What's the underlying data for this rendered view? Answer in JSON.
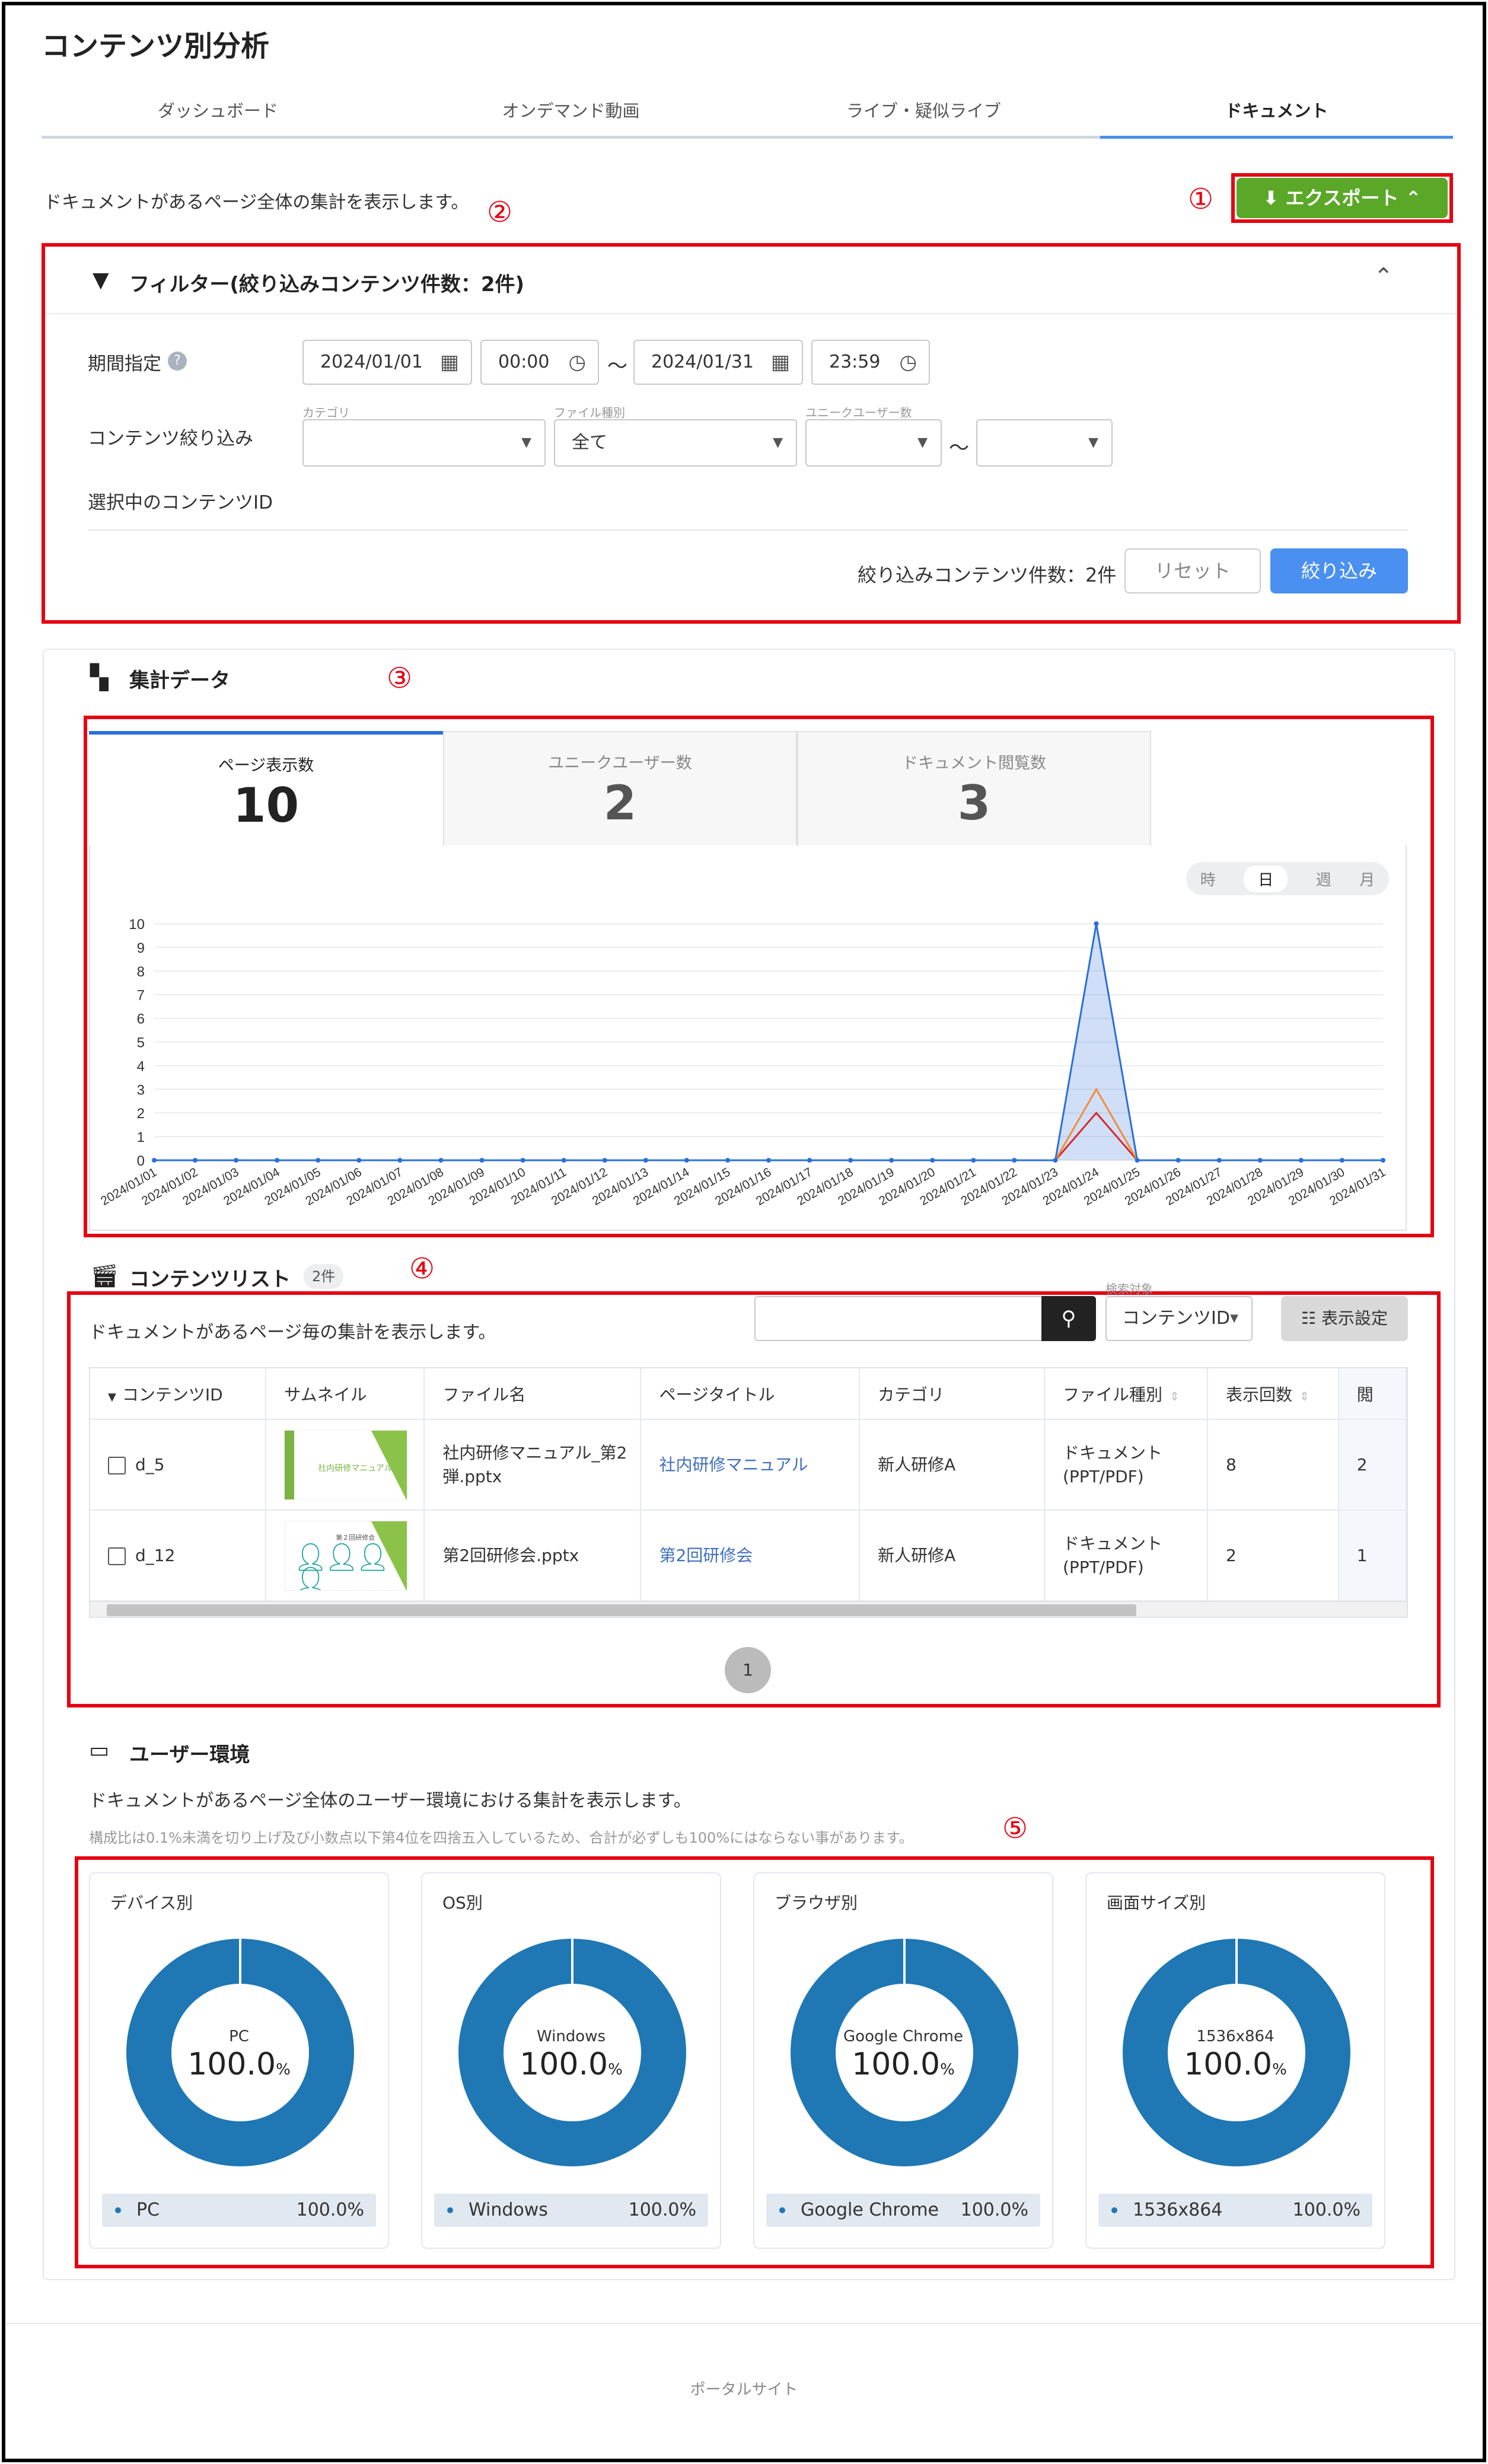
{
  "page": {
    "title": "コンテンツ別分析",
    "tabs": [
      "ダッシュボード",
      "オンデマンド動画",
      "ライブ・疑似ライブ",
      "ドキュメント"
    ],
    "description": "ドキュメントがあるページ全体の集計を表示します。",
    "export_label": "エクスポート",
    "markers": [
      "①",
      "②",
      "③",
      "④",
      "⑤"
    ],
    "footer": "ポータルサイト"
  },
  "filter": {
    "title": "フィルター(絞り込みコンテンツ件数：2件)",
    "period_label": "期間指定",
    "start_date": "2024/01/01",
    "start_time": "00:00",
    "range_sep": "～",
    "end_date": "2024/01/31",
    "end_time": "23:59",
    "content_filter_label": "コンテンツ絞り込み",
    "category_label": "カテゴリ",
    "category_value": "",
    "filetype_label": "ファイル種別",
    "filetype_value": "全て",
    "unique_users_label": "ユニークユーザー数",
    "selected_ids_label": "選択中のコンテンツID",
    "count_text": "絞り込みコンテンツ件数：2件",
    "reset_label": "リセット",
    "apply_label": "絞り込み"
  },
  "summary": {
    "title": "集計データ",
    "metrics": [
      {
        "label": "ページ表示数",
        "value": "10"
      },
      {
        "label": "ユニークユーザー数",
        "value": "2"
      },
      {
        "label": "ドキュメント閲覧数",
        "value": "3"
      }
    ],
    "granularity": [
      "時",
      "日",
      "週",
      "月"
    ],
    "granularity_selected": "日"
  },
  "chart_data": {
    "type": "area",
    "x": [
      "2024/01/01",
      "2024/01/02",
      "2024/01/03",
      "2024/01/04",
      "2024/01/05",
      "2024/01/06",
      "2024/01/07",
      "2024/01/08",
      "2024/01/09",
      "2024/01/10",
      "2024/01/11",
      "2024/01/12",
      "2024/01/13",
      "2024/01/14",
      "2024/01/15",
      "2024/01/16",
      "2024/01/17",
      "2024/01/18",
      "2024/01/19",
      "2024/01/20",
      "2024/01/21",
      "2024/01/22",
      "2024/01/23",
      "2024/01/24",
      "2024/01/25",
      "2024/01/26",
      "2024/01/27",
      "2024/01/28",
      "2024/01/29",
      "2024/01/30",
      "2024/01/31"
    ],
    "ylim": [
      0,
      10
    ],
    "yticks": [
      0,
      1,
      2,
      3,
      4,
      5,
      6,
      7,
      8,
      9,
      10
    ],
    "series": [
      {
        "color": "#2a6fdb",
        "values": [
          0,
          0,
          0,
          0,
          0,
          0,
          0,
          0,
          0,
          0,
          0,
          0,
          0,
          0,
          0,
          0,
          0,
          0,
          0,
          0,
          0,
          0,
          0,
          10,
          0,
          0,
          0,
          0,
          0,
          0,
          0
        ]
      },
      {
        "color": "#f28c38",
        "values": [
          0,
          0,
          0,
          0,
          0,
          0,
          0,
          0,
          0,
          0,
          0,
          0,
          0,
          0,
          0,
          0,
          0,
          0,
          0,
          0,
          0,
          0,
          0,
          3,
          0,
          0,
          0,
          0,
          0,
          0,
          0
        ]
      },
      {
        "color": "#d62728",
        "values": [
          0,
          0,
          0,
          0,
          0,
          0,
          0,
          0,
          0,
          0,
          0,
          0,
          0,
          0,
          0,
          0,
          0,
          0,
          0,
          0,
          0,
          0,
          0,
          2,
          0,
          0,
          0,
          0,
          0,
          0,
          0
        ]
      }
    ],
    "grid": true
  },
  "contents": {
    "title": "コンテンツリスト",
    "count_badge": "2件",
    "description": "ドキュメントがあるページ毎の集計を表示します。",
    "search_target_label": "検索対象",
    "search_placeholder": "",
    "search_target_value": "コンテンツID",
    "display_settings_label": "表示設定",
    "columns": [
      "コンテンツID",
      "サムネイル",
      "ファイル名",
      "ページタイトル",
      "カテゴリ",
      "ファイル種別",
      "表示回数",
      "閲"
    ],
    "rows": [
      {
        "id": "d_5",
        "thumb_text": "社内研修マニュアル",
        "file": "社内研修マニュアル_第2弾.pptx",
        "page_title": "社内研修マニュアル",
        "category": "新人研修A",
        "filetype": "ドキュメント(PPT/PDF)",
        "views": "8",
        "next": "2"
      },
      {
        "id": "d_12",
        "thumb_text": "第２回研修会",
        "file": "第2回研修会.pptx",
        "page_title": "第2回研修会",
        "category": "新人研修A",
        "filetype": "ドキュメント(PPT/PDF)",
        "views": "2",
        "next": "1"
      }
    ],
    "page_number": "1"
  },
  "environment": {
    "title": "ユーザー環境",
    "description": "ドキュメントがあるページ全体のユーザー環境における集計を表示します。",
    "note": "構成比は0.1%未満を切り上げ及び小数点以下第4位を四捨五入しているため、合計が必ずしも100%にはならない事があります。",
    "cards": [
      {
        "title": "デバイス別",
        "label": "PC",
        "value": "100.0",
        "unit": "%",
        "legend_value": "100.0%"
      },
      {
        "title": "OS別",
        "label": "Windows",
        "value": "100.0",
        "unit": "%",
        "legend_value": "100.0%"
      },
      {
        "title": "ブラウザ別",
        "label": "Google Chrome",
        "value": "100.0",
        "unit": "%",
        "legend_value": "100.0%"
      },
      {
        "title": "画面サイズ別",
        "label": "1536x864",
        "value": "100.0",
        "unit": "%",
        "legend_value": "100.0%"
      }
    ],
    "donut_color": "#1f77b4"
  }
}
